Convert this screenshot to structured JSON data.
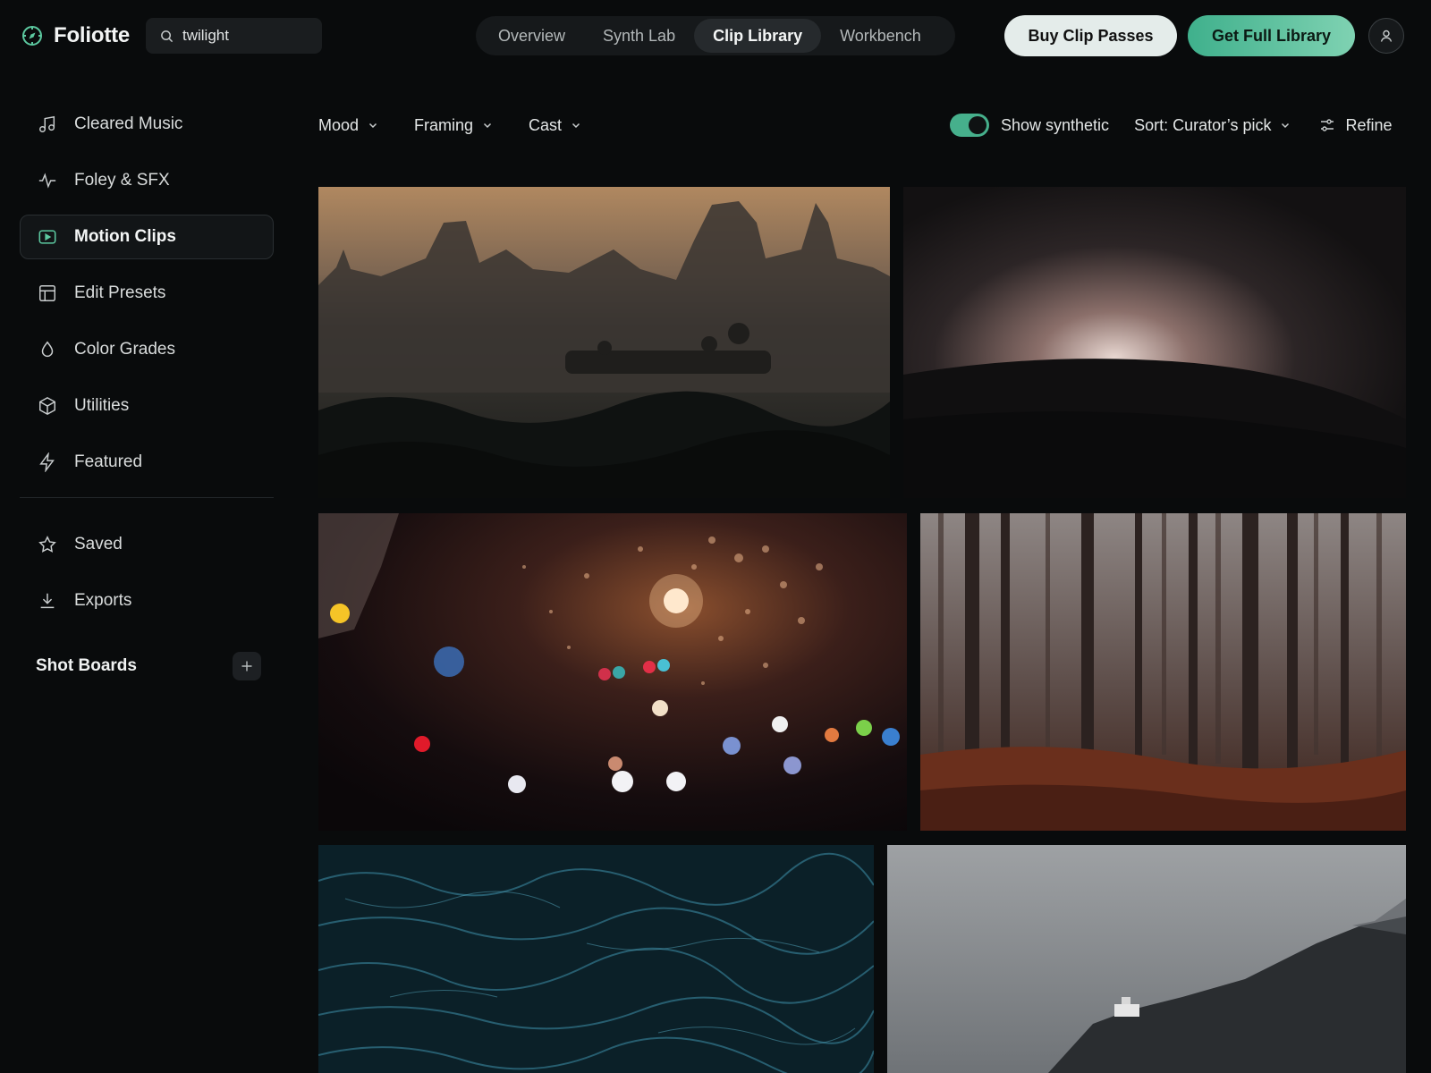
{
  "app": {
    "name": "Foliotte",
    "logo_icon": "compass-icon"
  },
  "search": {
    "value": "twilight",
    "icon": "search-icon"
  },
  "nav": {
    "tabs": [
      {
        "label": "Overview",
        "active": false
      },
      {
        "label": "Synth Lab",
        "active": false
      },
      {
        "label": "Clip Library",
        "active": true
      },
      {
        "label": "Workbench",
        "active": false
      }
    ]
  },
  "actions": {
    "buy": "Buy Clip Passes",
    "get": "Get Full Library",
    "avatar_icon": "user-icon"
  },
  "sidebar": {
    "items": [
      {
        "label": "Cleared Music",
        "icon": "music-note-icon",
        "active": false
      },
      {
        "label": "Foley & SFX",
        "icon": "waveform-icon",
        "active": false
      },
      {
        "label": "Motion Clips",
        "icon": "play-icon",
        "active": true
      },
      {
        "label": "Edit Presets",
        "icon": "layout-icon",
        "active": false
      },
      {
        "label": "Color Grades",
        "icon": "droplet-icon",
        "active": false
      },
      {
        "label": "Utilities",
        "icon": "cube-icon",
        "active": false
      },
      {
        "label": "Featured",
        "icon": "bolt-icon",
        "active": false
      }
    ],
    "secondary": [
      {
        "label": "Saved",
        "icon": "star-icon"
      },
      {
        "label": "Exports",
        "icon": "download-icon"
      }
    ],
    "boards": {
      "label": "Shot Boards",
      "add_icon": "plus-icon"
    }
  },
  "filters": {
    "items": [
      {
        "label": "Mood"
      },
      {
        "label": "Framing"
      },
      {
        "label": "Cast"
      }
    ],
    "show_synthetic": {
      "label": "Show synthetic",
      "on": true
    },
    "sort": {
      "label": "Sort: Curator’s pick"
    },
    "refine": {
      "label": "Refine",
      "icon": "sliders-icon"
    }
  },
  "colors": {
    "accent": "#46b08c",
    "accent_light": "#7fd2b2",
    "background": "#090b0c"
  }
}
